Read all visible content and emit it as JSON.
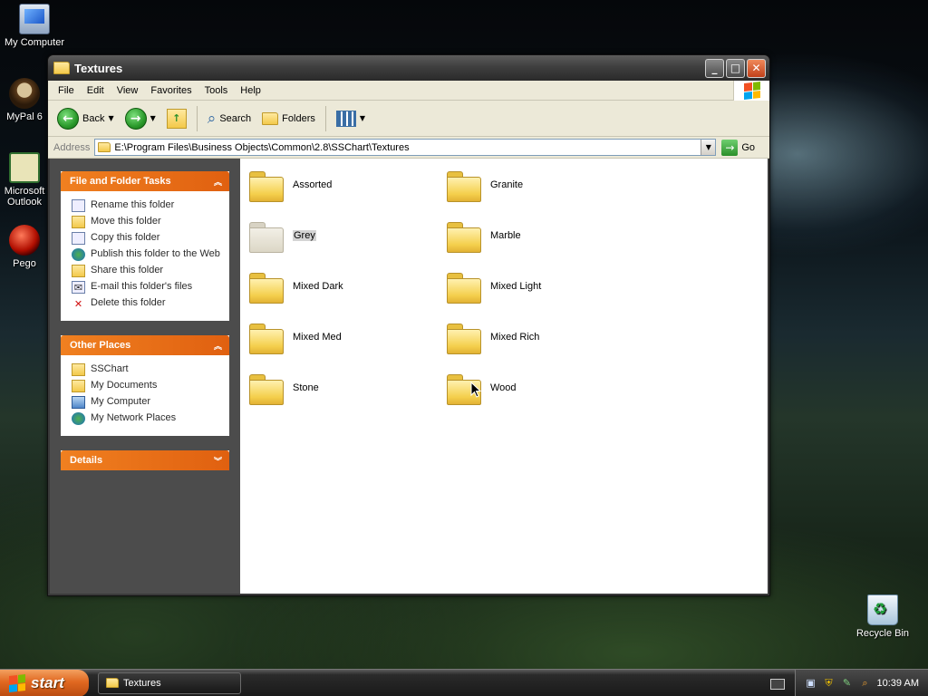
{
  "desktop": {
    "icons": [
      {
        "label": "My Computer"
      },
      {
        "label": "MyPal 6"
      },
      {
        "label": "Microsoft Outlook"
      },
      {
        "label": "Pego"
      },
      {
        "label": "Recycle Bin"
      }
    ]
  },
  "window": {
    "title": "Textures",
    "menu": [
      "File",
      "Edit",
      "View",
      "Favorites",
      "Tools",
      "Help"
    ],
    "toolbar": {
      "back": "Back",
      "search": "Search",
      "folders": "Folders"
    },
    "address": {
      "label": "Address",
      "value": "E:\\Program Files\\Business Objects\\Common\\2.8\\SSChart\\Textures",
      "go": "Go"
    },
    "task_panels": {
      "file_folder_tasks": {
        "title": "File and Folder Tasks",
        "items": [
          {
            "label": "Rename this folder",
            "icon": "rename-icon"
          },
          {
            "label": "Move this folder",
            "icon": "move-icon"
          },
          {
            "label": "Copy this folder",
            "icon": "copy-icon"
          },
          {
            "label": "Publish this folder to the Web",
            "icon": "globe-icon"
          },
          {
            "label": "Share this folder",
            "icon": "share-icon"
          },
          {
            "label": "E-mail this folder's files",
            "icon": "email-icon"
          },
          {
            "label": "Delete this folder",
            "icon": "delete-icon"
          }
        ]
      },
      "other_places": {
        "title": "Other Places",
        "items": [
          {
            "label": "SSChart"
          },
          {
            "label": "My Documents"
          },
          {
            "label": "My Computer"
          },
          {
            "label": "My Network Places"
          }
        ]
      },
      "details": {
        "title": "Details"
      }
    },
    "folders": [
      {
        "name": "Assorted"
      },
      {
        "name": "Granite"
      },
      {
        "name": "Grey",
        "selected": true
      },
      {
        "name": "Marble"
      },
      {
        "name": "Mixed Dark"
      },
      {
        "name": "Mixed Light"
      },
      {
        "name": "Mixed Med"
      },
      {
        "name": "Mixed Rich"
      },
      {
        "name": "Stone"
      },
      {
        "name": "Wood"
      }
    ]
  },
  "taskbar": {
    "start": "start",
    "task_button": "Textures",
    "clock": "10:39 AM"
  },
  "colors": {
    "task_header": "#e06010",
    "taskpane_bg": "#4c4c4c",
    "selection": "#d4d4d4"
  }
}
